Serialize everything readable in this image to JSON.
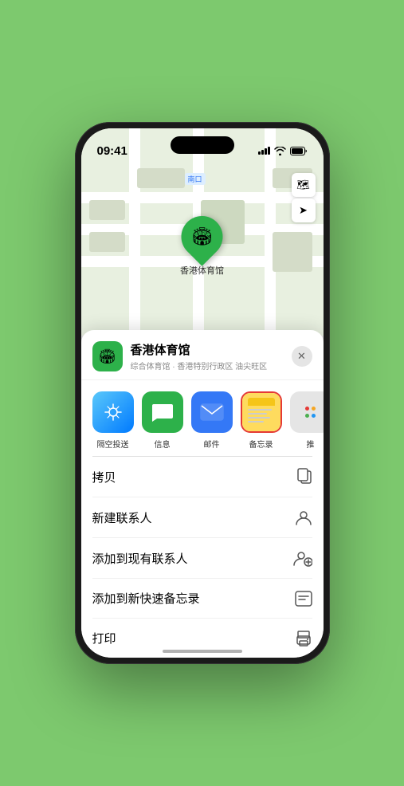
{
  "status_bar": {
    "time": "09:41",
    "signal_icon": "▲",
    "wifi": "wifi",
    "battery": "🔋"
  },
  "map": {
    "label": "南口",
    "map_icon": "🗺",
    "location_icon": "➤"
  },
  "venue": {
    "name": "香港体育馆",
    "subtitle": "综合体育馆 · 香港特别行政区 油尖旺区",
    "icon": "🏟"
  },
  "share_items": [
    {
      "id": "airdrop",
      "label": "隔空投送",
      "icon": "📡"
    },
    {
      "id": "messages",
      "label": "信息",
      "icon": "💬"
    },
    {
      "id": "mail",
      "label": "邮件",
      "icon": "✉"
    },
    {
      "id": "notes",
      "label": "备忘录",
      "icon": ""
    },
    {
      "id": "more",
      "label": "推",
      "icon": "···"
    }
  ],
  "actions": [
    {
      "label": "拷贝",
      "icon": "⧉"
    },
    {
      "label": "新建联系人",
      "icon": "👤"
    },
    {
      "label": "添加到现有联系人",
      "icon": "👤+"
    },
    {
      "label": "添加到新快速备忘录",
      "icon": "📋"
    },
    {
      "label": "打印",
      "icon": "🖨"
    }
  ],
  "close_btn": "✕",
  "home_indicator": ""
}
